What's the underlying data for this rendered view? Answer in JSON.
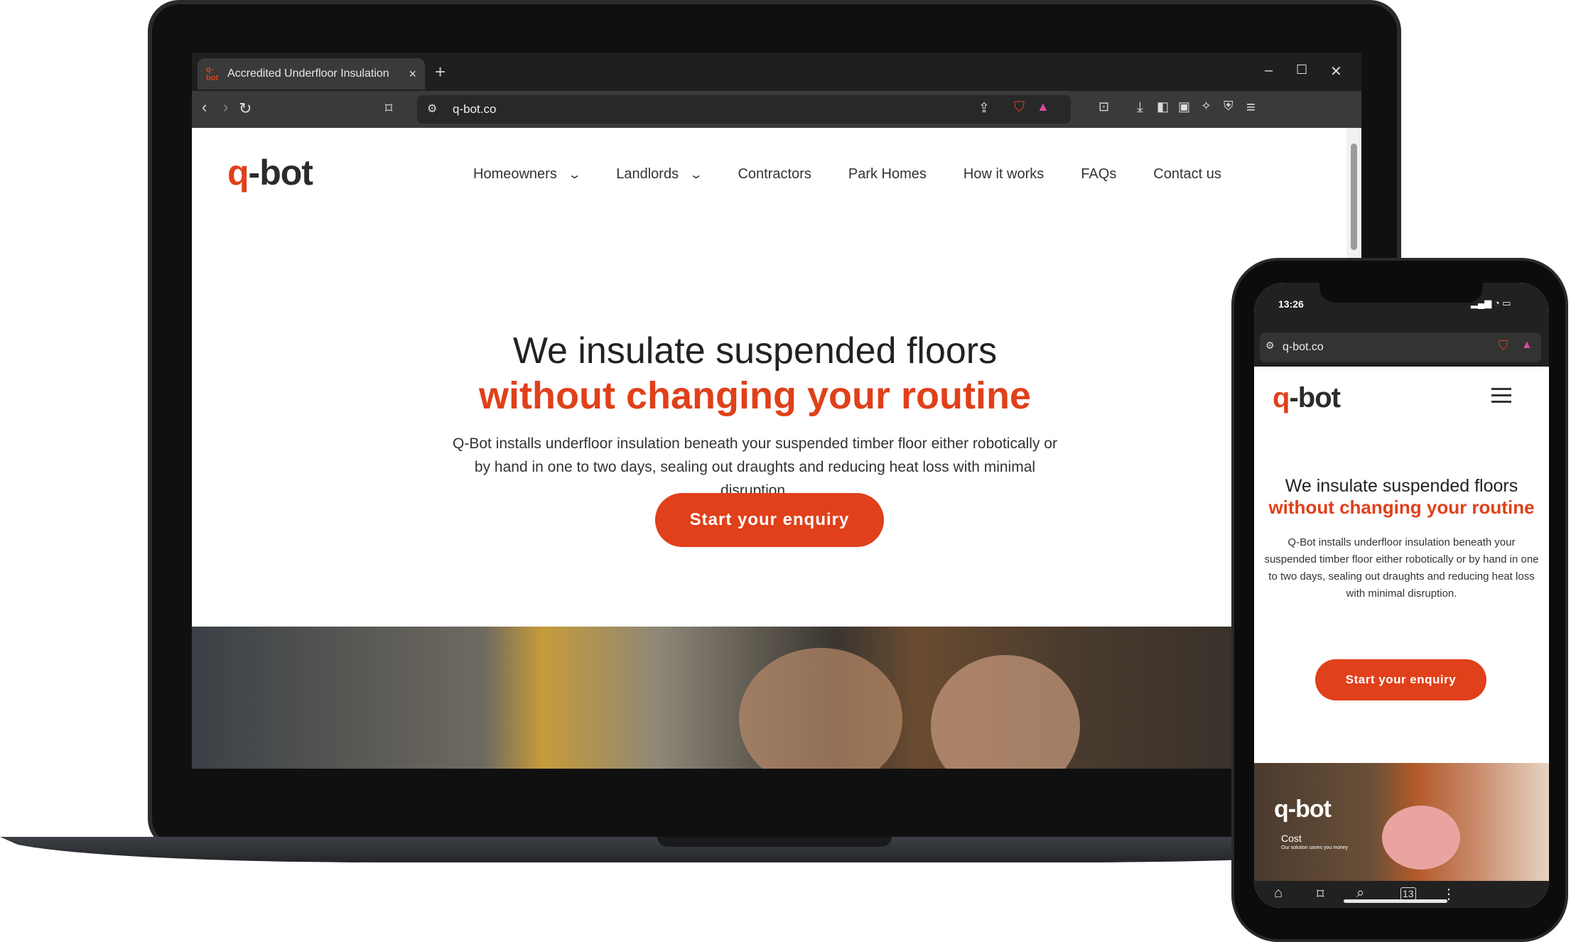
{
  "laptop": {
    "browser": {
      "tab_title": "Accredited Underfloor Insulation",
      "tab_favicon": "q-bot",
      "url": "q-bot.co",
      "new_tab_symbol": "+",
      "close_tab_symbol": "×"
    },
    "site": {
      "logo": {
        "q": "q",
        "rest": "-bot"
      },
      "nav": [
        {
          "label": "Homeowners",
          "dropdown": true
        },
        {
          "label": "Landlords",
          "dropdown": true
        },
        {
          "label": "Contractors",
          "dropdown": false
        },
        {
          "label": "Park Homes",
          "dropdown": false
        },
        {
          "label": "How it works",
          "dropdown": false
        },
        {
          "label": "FAQs",
          "dropdown": false
        },
        {
          "label": "Contact us",
          "dropdown": false
        }
      ],
      "headline_line1": "We insulate suspended floors",
      "headline_line2": "without changing your routine",
      "lead": "Q-Bot installs underfloor insulation beneath your suspended timber floor either robotically or by hand in one to two days, sealing out draughts and reducing heat loss with minimal disruption.",
      "cta": "Start your enquiry"
    }
  },
  "phone": {
    "status_time": "13:26",
    "url": "q-bot.co",
    "headline_line1": "We insulate suspended floors",
    "headline_line2": "without changing your routine",
    "lead": "Q-Bot installs underfloor insulation beneath your suspended timber floor either robotically or by hand in one to two days, sealing out draughts and reducing heat loss with minimal disruption.",
    "cta": "Start your enquiry",
    "promo": {
      "title": "Cost",
      "subtitle": "Our solution saves you money",
      "logo": "q-bot"
    }
  },
  "colors": {
    "brand": "#e0401a",
    "text": "#222222"
  }
}
